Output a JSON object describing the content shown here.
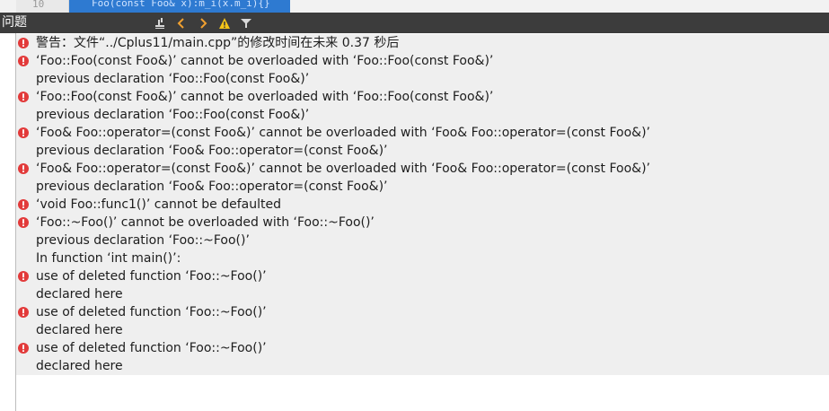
{
  "editor": {
    "line_number": "10",
    "code": "Foo(const Foo& x):m_i(x.m_i){}"
  },
  "panel": {
    "title": "问题"
  },
  "issues": [
    {
      "kind": "error",
      "text": "警告：文件“../Cplus11/main.cpp”的修改时间在未来 0.37 秒后"
    },
    {
      "kind": "error",
      "text": "‘Foo::Foo(const Foo&)’ cannot be overloaded with ‘Foo::Foo(const Foo&)’"
    },
    {
      "kind": "note",
      "text": "previous declaration ‘Foo::Foo(const Foo&)’"
    },
    {
      "kind": "error",
      "text": "‘Foo::Foo(const Foo&)’ cannot be overloaded with ‘Foo::Foo(const Foo&)’"
    },
    {
      "kind": "note",
      "text": "previous declaration ‘Foo::Foo(const Foo&)’"
    },
    {
      "kind": "error",
      "text": "‘Foo& Foo::operator=(const Foo&)’ cannot be overloaded with ‘Foo& Foo::operator=(const Foo&)’"
    },
    {
      "kind": "note",
      "text": "previous declaration ‘Foo& Foo::operator=(const Foo&)’"
    },
    {
      "kind": "error",
      "text": "‘Foo& Foo::operator=(const Foo&)’ cannot be overloaded with ‘Foo& Foo::operator=(const Foo&)’"
    },
    {
      "kind": "note",
      "text": "previous declaration ‘Foo& Foo::operator=(const Foo&)’"
    },
    {
      "kind": "error",
      "text": "‘void Foo::func1()’ cannot be defaulted"
    },
    {
      "kind": "error",
      "text": "‘Foo::~Foo()’ cannot be overloaded with ‘Foo::~Foo()’"
    },
    {
      "kind": "note",
      "text": "previous declaration ‘Foo::~Foo()’"
    },
    {
      "kind": "note",
      "text": "In function ‘int main()’:"
    },
    {
      "kind": "error",
      "text": "use of deleted function ‘Foo::~Foo()’"
    },
    {
      "kind": "note",
      "text": "declared here"
    },
    {
      "kind": "error",
      "text": "use of deleted function ‘Foo::~Foo()’"
    },
    {
      "kind": "note",
      "text": "declared here"
    },
    {
      "kind": "error",
      "text": "use of deleted function ‘Foo::~Foo()’"
    },
    {
      "kind": "note",
      "text": "declared here"
    }
  ],
  "toolbar": {
    "buttons": [
      "clean-issues-icon",
      "previous-arrow-icon",
      "next-arrow-icon",
      "warning-filter-icon",
      "filter-icon"
    ]
  },
  "colors": {
    "error_icon": "#e23a3a",
    "header_bg": "#3c3c3c",
    "arrow": "#f0a030",
    "warning_yellow": "#f5c518"
  }
}
